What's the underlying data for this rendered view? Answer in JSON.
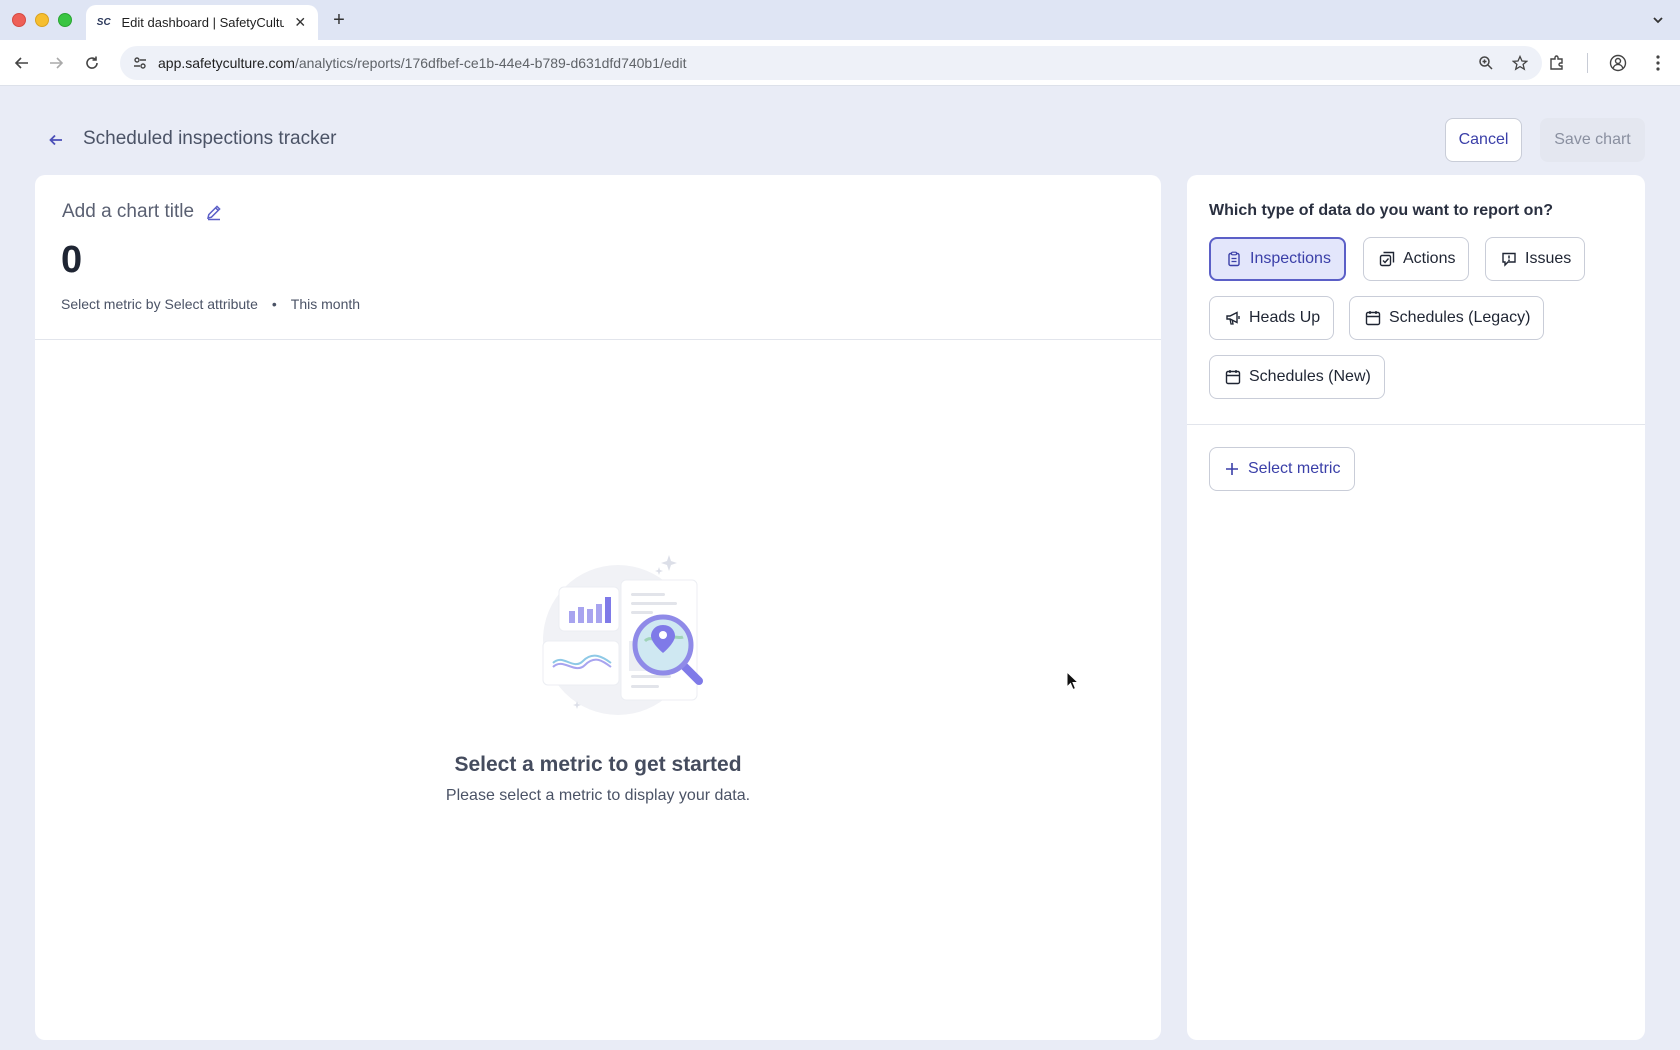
{
  "browser": {
    "tab_title": "Edit dashboard | SafetyCulture",
    "tab_favicon": "SC",
    "url_host": "app.safetyculture.com",
    "url_path": "/analytics/reports/176dfbef-ce1b-44e4-b789-d631dfd740b1/edit"
  },
  "header": {
    "title": "Scheduled inspections tracker",
    "cancel_label": "Cancel",
    "save_label": "Save chart"
  },
  "chart": {
    "title_placeholder": "Add a chart title",
    "value": "0",
    "subtitle_metric": "Select metric by Select attribute",
    "subtitle_separator": "•",
    "subtitle_period": "This month",
    "empty_title": "Select a metric to get started",
    "empty_subtitle": "Please select a metric to display your data."
  },
  "side": {
    "heading": "Which type of data do you want to report on?",
    "data_types": [
      {
        "label": "Inspections",
        "icon": "clipboard-icon",
        "active": true
      },
      {
        "label": "Actions",
        "icon": "checkbox-stack-icon",
        "active": false
      },
      {
        "label": "Issues",
        "icon": "alert-bubble-icon",
        "active": false
      },
      {
        "label": "Heads Up",
        "icon": "megaphone-icon",
        "active": false
      },
      {
        "label": "Schedules (Legacy)",
        "icon": "calendar-icon",
        "active": false
      },
      {
        "label": "Schedules (New)",
        "icon": "calendar-icon",
        "active": false
      }
    ],
    "select_metric_label": "Select metric"
  },
  "colors": {
    "accent": "#5b5fc7",
    "accent_text": "#3a3fa8",
    "active_chip_bg": "#e3e6fb",
    "page_bg": "#e9ecf6"
  }
}
